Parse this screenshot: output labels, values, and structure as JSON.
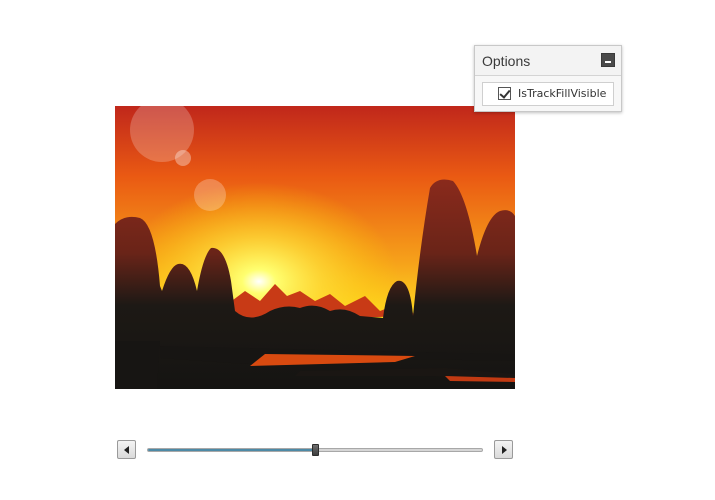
{
  "options": {
    "title": "Options",
    "collapse_icon": "minimize-icon",
    "items": [
      {
        "label": "IsTrackFillVisible",
        "checked": true
      }
    ]
  },
  "image": {
    "description_icon": "sunset-landscape-image"
  },
  "slider": {
    "value": 0.5,
    "track_fill_visible": true,
    "fill_color": "#4d8aa6",
    "decrease_icon": "arrow-left-icon",
    "increase_icon": "arrow-right-icon"
  }
}
